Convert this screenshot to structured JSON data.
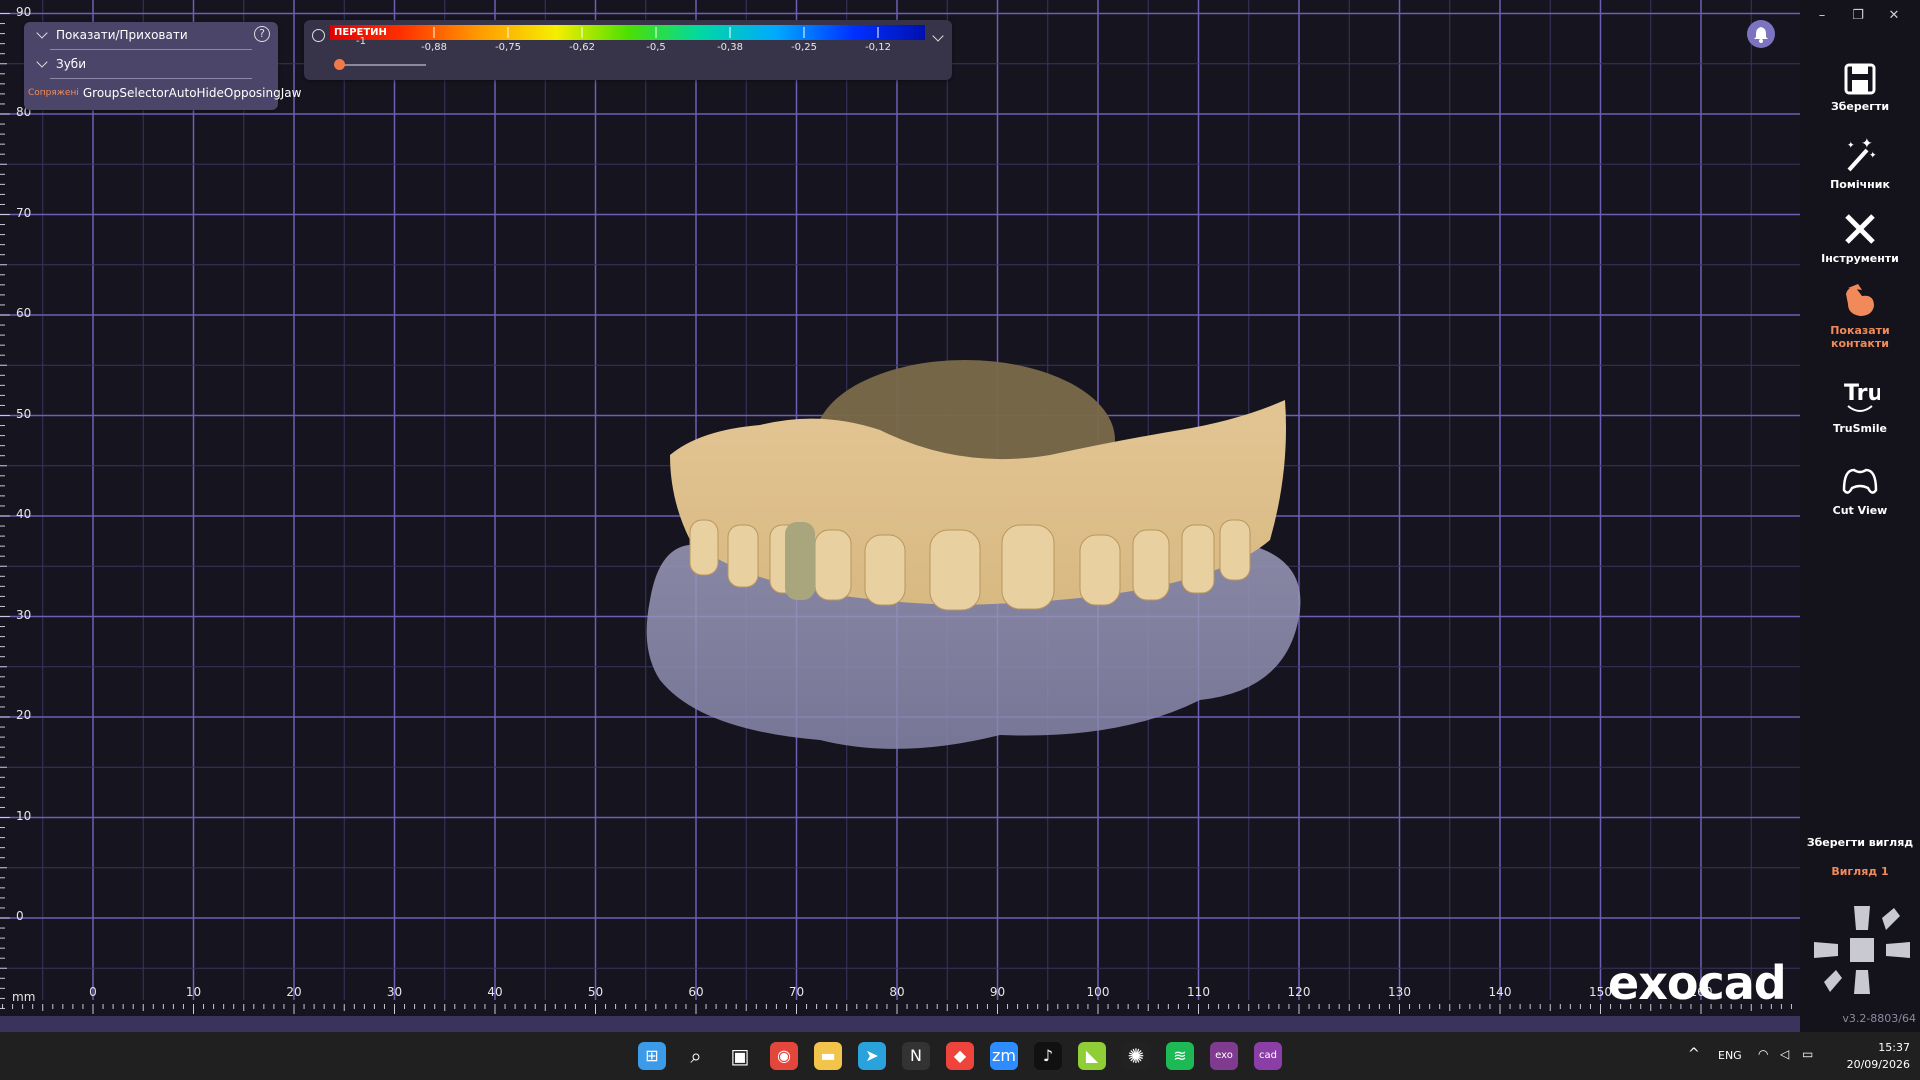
{
  "show_hide": {
    "title": "Показати/Приховати",
    "teeth": "Зуби",
    "jaw_toggle": "GroupSelectorAutoHideOpposingJaw",
    "jaw_overlay": "Сопряжені",
    "help": "?"
  },
  "color_scale": {
    "label": "ПЕРЕТИН",
    "ticks": [
      "-1",
      "-0,88",
      "-0,75",
      "-0,62",
      "-0,5",
      "-0,38",
      "-0,25",
      "-0,12"
    ],
    "slider_value": 0.0
  },
  "tools": [
    {
      "label": "Зберегти",
      "icon": "save-icon"
    },
    {
      "label": "Помічник",
      "icon": "magic-wand-icon"
    },
    {
      "label": "Інструменти",
      "icon": "tools-icon"
    },
    {
      "label": "Показати контакти",
      "icon": "contacts-icon"
    },
    {
      "label": "TruSmile",
      "icon": "trusmile-icon"
    },
    {
      "label": "Cut View",
      "icon": "cut-view-icon"
    }
  ],
  "save_view": "Зберегти вигляд",
  "view1": "Вигляд 1",
  "version": "v3.2-8803/64",
  "logo": "exocad",
  "axis": {
    "unit": "mm",
    "x_labels": [
      "0",
      "10",
      "20",
      "30",
      "40",
      "50",
      "60",
      "70",
      "80",
      "90",
      "100",
      "110",
      "120",
      "130",
      "140",
      "150",
      "160"
    ],
    "y_labels": [
      "90",
      "80",
      "70",
      "60",
      "50",
      "40",
      "30",
      "20",
      "10",
      "0"
    ]
  },
  "taskbar": {
    "lang": "ENG",
    "time": "15:37",
    "date": "20/09/2026",
    "apps": [
      "windows-start",
      "search",
      "task-view",
      "chrome",
      "file-explorer",
      "telegram",
      "notion",
      "anydesk",
      "zoom",
      "tiktok",
      "spotify-alt",
      "chatgpt",
      "spotify",
      "exocad",
      "cad"
    ]
  },
  "colors": {
    "accent": "#f08a5a",
    "grid": "#6d5fb5",
    "panel": "#4b4569"
  }
}
